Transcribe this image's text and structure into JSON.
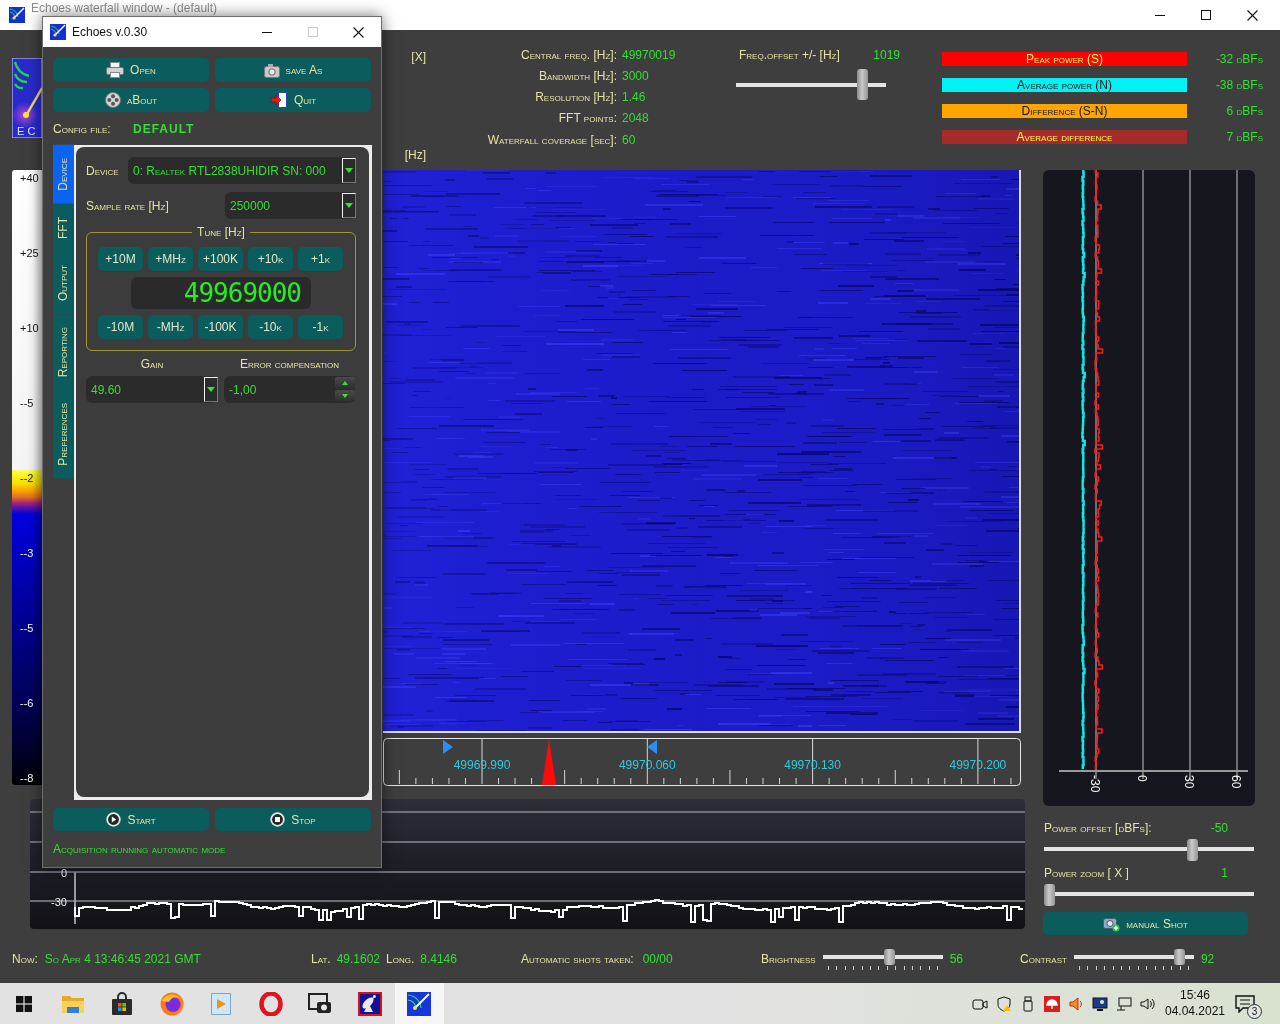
{
  "main_window": {
    "title": "Echoes waterfall window - (default)"
  },
  "logo": {
    "text": "E C"
  },
  "header": {
    "x_unit": "[X]",
    "hz_unit": "[Hz]",
    "params": [
      {
        "label": "Central freq. [Hz]:",
        "value": "49970019"
      },
      {
        "label": "Bandwidth [Hz]:",
        "value": "3000"
      },
      {
        "label": "Resolution [Hz]:",
        "value": "1.46"
      },
      {
        "label": "FFT points:",
        "value": "2048"
      },
      {
        "label": "Waterfall coverage [sec]:",
        "value": "60"
      }
    ],
    "freq_offset": {
      "label": "Freq.offset +/- [Hz]",
      "value": "1019",
      "level": 0.87
    },
    "legend": [
      {
        "label": "Peak power (S)",
        "color": "#ff0000",
        "value": "-32 dBFs"
      },
      {
        "label": "Average power (N)",
        "color": "#00f2f2",
        "value": "-38 dBFs"
      },
      {
        "label": "Difference (S-N)",
        "color": "#ffa500",
        "value": "6 dBFs"
      },
      {
        "label": "Average difference",
        "color": "#a52a2a",
        "value": "7 dBFs"
      }
    ]
  },
  "color_scale": {
    "labels": [
      "+40",
      "+25",
      "+10",
      "--5",
      "--2",
      "--3",
      "--5",
      "--6",
      "--8"
    ]
  },
  "frequency_axis": {
    "labels": [
      "49969.990",
      "49970.060",
      "49970.130",
      "49970.200"
    ]
  },
  "spectrum": {
    "axis_labels": [
      "-30",
      "0",
      "30",
      "60"
    ]
  },
  "power_chart": {
    "y_labels": [
      "0",
      "-30"
    ]
  },
  "power_offset": {
    "label": "Power offset [dBFs]:",
    "value": "-50",
    "level": 0.72
  },
  "power_zoom": {
    "label": "Power zoom [ X ]",
    "value": "1",
    "level": 0
  },
  "manual_shot": {
    "label": "manual Shot"
  },
  "status_bar": {
    "now_label": "Now:",
    "now": "So Apr 4 13:46:45 2021 GMT",
    "lat_label": "Lat.",
    "lat": "49.1602",
    "long_label": "Long.",
    "long": "8.4146",
    "shots_label": "Automatic shots taken:",
    "shots": "00/00",
    "brightness": {
      "label": "Brightness",
      "value": "56",
      "level": 0.56
    },
    "contrast": {
      "label": "Contrast",
      "value": "92",
      "level": 0.92
    }
  },
  "dialog": {
    "title": "Echoes v.0.30",
    "maximize_disabled": true,
    "open": "Open",
    "save_as": "save As",
    "about": "aBout",
    "quit": "Quit",
    "config_label": "Config file:",
    "config_value": "DEFAULT",
    "tabs": [
      {
        "label": "Device",
        "selected": true
      },
      {
        "label": "FFT",
        "selected": false
      },
      {
        "label": "Output",
        "selected": false
      },
      {
        "label": "Reporting",
        "selected": false
      },
      {
        "label": "Preferences",
        "selected": false
      }
    ],
    "device": {
      "label": "Device",
      "value": "0: Realtek RTL2838UHIDIR SN: 000"
    },
    "sample_rate": {
      "label": "Sample rate [Hz]",
      "value": "250000"
    },
    "tune": {
      "label": "Tune [Hz]",
      "up": [
        "+10M",
        "+MHz",
        "+100K",
        "+10k",
        "+1k"
      ],
      "display": "49969000",
      "down": [
        "-10M",
        "-MHz",
        "-100K",
        "-10k",
        "-1k"
      ]
    },
    "gain": {
      "label": "Gain",
      "value": "49.60"
    },
    "error_compensation": {
      "label": "Error compensation",
      "value": "-1,00"
    },
    "start": "Start",
    "stop": "Stop",
    "status": "Acquisition running automatic mode"
  },
  "taskbar": {
    "apps": [
      {
        "kind": "folder",
        "selected": false
      },
      {
        "kind": "bag",
        "selected": false
      },
      {
        "kind": "globe",
        "selected": false
      },
      {
        "kind": "player",
        "selected": false
      },
      {
        "kind": "ring",
        "selected": false
      },
      {
        "kind": "screenshot",
        "selected": false
      },
      {
        "kind": "dish",
        "selected": false
      },
      {
        "kind": "comet",
        "selected": true
      }
    ],
    "time": "15:46",
    "date": "04.04.2021",
    "notifications": "3"
  }
}
